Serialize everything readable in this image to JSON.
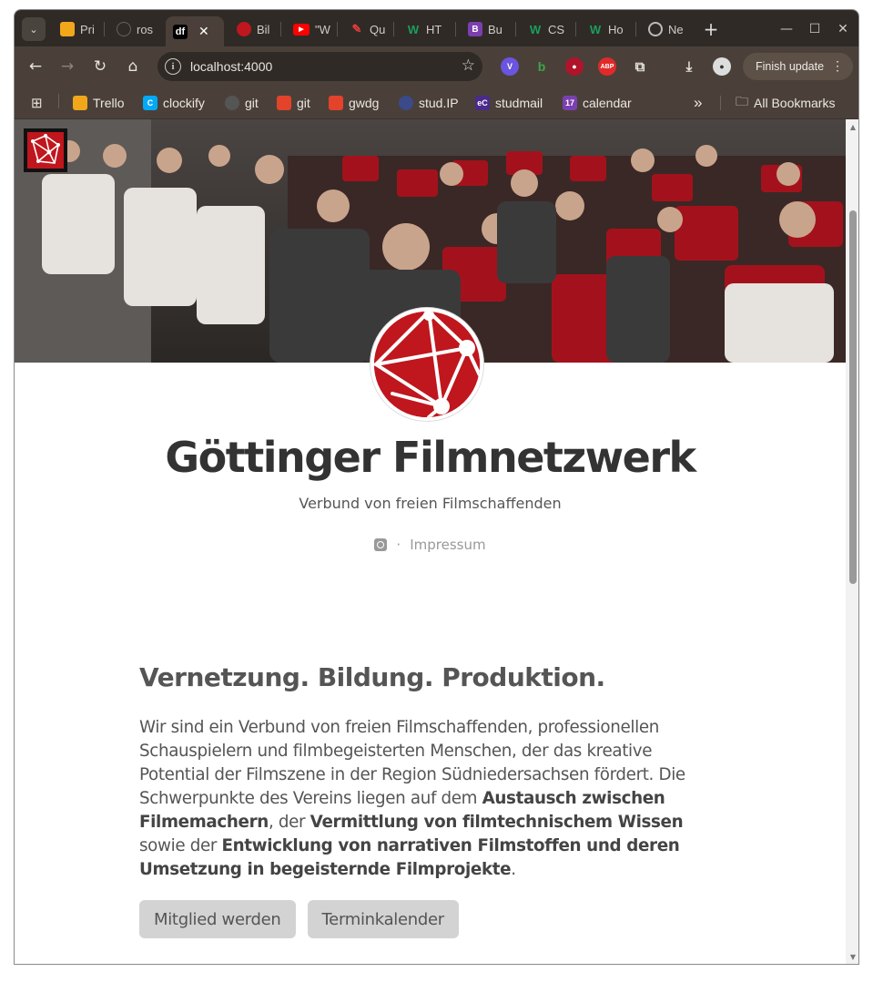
{
  "browser": {
    "tabs": [
      {
        "label": "Pri",
        "favicon": "trello-icon",
        "color": "#f2a71b"
      },
      {
        "label": "ros",
        "favicon": "github-icon",
        "color": "#2f2a26"
      },
      {
        "label": "",
        "favicon": "df-icon",
        "color": "#000000",
        "active": true
      },
      {
        "label": "Bil",
        "favicon": "network-icon",
        "color": "#c0161d"
      },
      {
        "label": "\"W",
        "favicon": "youtube-icon",
        "color": "#ff0000"
      },
      {
        "label": "Qu",
        "favicon": "pencil-icon",
        "color": "#e23c3c"
      },
      {
        "label": "HT",
        "favicon": "w-icon",
        "color": "#1a7f4b"
      },
      {
        "label": "Bu",
        "favicon": "b-icon",
        "color": "#7b3fb0"
      },
      {
        "label": "CS",
        "favicon": "w-icon",
        "color": "#1a7f4b"
      },
      {
        "label": "Ho",
        "favicon": "w-icon",
        "color": "#1a7f4b"
      },
      {
        "label": "Ne",
        "favicon": "chrome-icon",
        "color": "#888888"
      }
    ],
    "active_tab_favicon_text": "df",
    "address": "localhost:4000",
    "finish_update_label": "Finish update",
    "bookmarks": [
      {
        "label": "Trello",
        "icon": "trello-icon",
        "color": "#f2a71b"
      },
      {
        "label": "clockify",
        "icon": "clockify-icon",
        "color": "#03a9f4"
      },
      {
        "label": "git",
        "icon": "github-icon",
        "color": "#555555"
      },
      {
        "label": "git",
        "icon": "gitlab-icon",
        "color": "#e2432a"
      },
      {
        "label": "gwdg",
        "icon": "gitlab-icon",
        "color": "#e2432a"
      },
      {
        "label": "stud.IP",
        "icon": "studip-icon",
        "color": "#3a4a8a"
      },
      {
        "label": "studmail",
        "icon": "studmail-icon",
        "color": "#4b2a8a"
      },
      {
        "label": "calendar",
        "icon": "calendar-icon",
        "color": "#7b3fb0"
      }
    ],
    "calendar_icon_text": "17",
    "all_bookmarks_label": "All Bookmarks",
    "overflow_label": "»"
  },
  "page": {
    "title": "Göttinger Filmnetzwerk",
    "subtitle": "Verbund von freien Filmschaffenden",
    "social_separator": "·",
    "impressum_label": "Impressum",
    "headline": "Vernetzung. Bildung. Produktion.",
    "lead": {
      "t1": "Wir sind ein Verbund von freien Filmschaffenden, professionellen Schauspielern und filmbegeisterten Menschen, der das kreative Potential der Filmszene in der Region Südniedersachsen fördert. Die Schwerpunkte des Vereins liegen auf dem ",
      "b1": "Austausch zwischen Filmemachern",
      "t2": ", der ",
      "b2": "Vermittlung von filmtechnischem Wissen",
      "t3": " sowie der ",
      "b3": "Entwicklung von narrativen Filmstoffen und deren Umsetzung in begeisternde Filmprojekte",
      "t4": "."
    },
    "buttons": {
      "join_label": "Mitglied werden",
      "calendar_label": "Terminkalender"
    }
  },
  "colors": {
    "brand_red": "#c0161d",
    "text": "#555555",
    "button_bg": "#d3d3d3"
  }
}
